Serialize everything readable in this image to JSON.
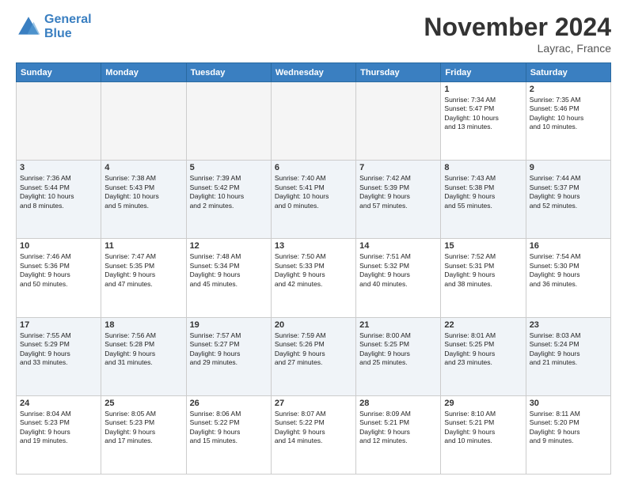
{
  "logo": {
    "line1": "General",
    "line2": "Blue"
  },
  "header": {
    "month": "November 2024",
    "location": "Layrac, France"
  },
  "weekdays": [
    "Sunday",
    "Monday",
    "Tuesday",
    "Wednesday",
    "Thursday",
    "Friday",
    "Saturday"
  ],
  "weeks": [
    [
      {
        "day": "",
        "info": "",
        "empty": true
      },
      {
        "day": "",
        "info": "",
        "empty": true
      },
      {
        "day": "",
        "info": "",
        "empty": true
      },
      {
        "day": "",
        "info": "",
        "empty": true
      },
      {
        "day": "",
        "info": "",
        "empty": true
      },
      {
        "day": "1",
        "info": "Sunrise: 7:34 AM\nSunset: 5:47 PM\nDaylight: 10 hours\nand 13 minutes.",
        "empty": false
      },
      {
        "day": "2",
        "info": "Sunrise: 7:35 AM\nSunset: 5:46 PM\nDaylight: 10 hours\nand 10 minutes.",
        "empty": false
      }
    ],
    [
      {
        "day": "3",
        "info": "Sunrise: 7:36 AM\nSunset: 5:44 PM\nDaylight: 10 hours\nand 8 minutes.",
        "empty": false
      },
      {
        "day": "4",
        "info": "Sunrise: 7:38 AM\nSunset: 5:43 PM\nDaylight: 10 hours\nand 5 minutes.",
        "empty": false
      },
      {
        "day": "5",
        "info": "Sunrise: 7:39 AM\nSunset: 5:42 PM\nDaylight: 10 hours\nand 2 minutes.",
        "empty": false
      },
      {
        "day": "6",
        "info": "Sunrise: 7:40 AM\nSunset: 5:41 PM\nDaylight: 10 hours\nand 0 minutes.",
        "empty": false
      },
      {
        "day": "7",
        "info": "Sunrise: 7:42 AM\nSunset: 5:39 PM\nDaylight: 9 hours\nand 57 minutes.",
        "empty": false
      },
      {
        "day": "8",
        "info": "Sunrise: 7:43 AM\nSunset: 5:38 PM\nDaylight: 9 hours\nand 55 minutes.",
        "empty": false
      },
      {
        "day": "9",
        "info": "Sunrise: 7:44 AM\nSunset: 5:37 PM\nDaylight: 9 hours\nand 52 minutes.",
        "empty": false
      }
    ],
    [
      {
        "day": "10",
        "info": "Sunrise: 7:46 AM\nSunset: 5:36 PM\nDaylight: 9 hours\nand 50 minutes.",
        "empty": false
      },
      {
        "day": "11",
        "info": "Sunrise: 7:47 AM\nSunset: 5:35 PM\nDaylight: 9 hours\nand 47 minutes.",
        "empty": false
      },
      {
        "day": "12",
        "info": "Sunrise: 7:48 AM\nSunset: 5:34 PM\nDaylight: 9 hours\nand 45 minutes.",
        "empty": false
      },
      {
        "day": "13",
        "info": "Sunrise: 7:50 AM\nSunset: 5:33 PM\nDaylight: 9 hours\nand 42 minutes.",
        "empty": false
      },
      {
        "day": "14",
        "info": "Sunrise: 7:51 AM\nSunset: 5:32 PM\nDaylight: 9 hours\nand 40 minutes.",
        "empty": false
      },
      {
        "day": "15",
        "info": "Sunrise: 7:52 AM\nSunset: 5:31 PM\nDaylight: 9 hours\nand 38 minutes.",
        "empty": false
      },
      {
        "day": "16",
        "info": "Sunrise: 7:54 AM\nSunset: 5:30 PM\nDaylight: 9 hours\nand 36 minutes.",
        "empty": false
      }
    ],
    [
      {
        "day": "17",
        "info": "Sunrise: 7:55 AM\nSunset: 5:29 PM\nDaylight: 9 hours\nand 33 minutes.",
        "empty": false
      },
      {
        "day": "18",
        "info": "Sunrise: 7:56 AM\nSunset: 5:28 PM\nDaylight: 9 hours\nand 31 minutes.",
        "empty": false
      },
      {
        "day": "19",
        "info": "Sunrise: 7:57 AM\nSunset: 5:27 PM\nDaylight: 9 hours\nand 29 minutes.",
        "empty": false
      },
      {
        "day": "20",
        "info": "Sunrise: 7:59 AM\nSunset: 5:26 PM\nDaylight: 9 hours\nand 27 minutes.",
        "empty": false
      },
      {
        "day": "21",
        "info": "Sunrise: 8:00 AM\nSunset: 5:25 PM\nDaylight: 9 hours\nand 25 minutes.",
        "empty": false
      },
      {
        "day": "22",
        "info": "Sunrise: 8:01 AM\nSunset: 5:25 PM\nDaylight: 9 hours\nand 23 minutes.",
        "empty": false
      },
      {
        "day": "23",
        "info": "Sunrise: 8:03 AM\nSunset: 5:24 PM\nDaylight: 9 hours\nand 21 minutes.",
        "empty": false
      }
    ],
    [
      {
        "day": "24",
        "info": "Sunrise: 8:04 AM\nSunset: 5:23 PM\nDaylight: 9 hours\nand 19 minutes.",
        "empty": false
      },
      {
        "day": "25",
        "info": "Sunrise: 8:05 AM\nSunset: 5:23 PM\nDaylight: 9 hours\nand 17 minutes.",
        "empty": false
      },
      {
        "day": "26",
        "info": "Sunrise: 8:06 AM\nSunset: 5:22 PM\nDaylight: 9 hours\nand 15 minutes.",
        "empty": false
      },
      {
        "day": "27",
        "info": "Sunrise: 8:07 AM\nSunset: 5:22 PM\nDaylight: 9 hours\nand 14 minutes.",
        "empty": false
      },
      {
        "day": "28",
        "info": "Sunrise: 8:09 AM\nSunset: 5:21 PM\nDaylight: 9 hours\nand 12 minutes.",
        "empty": false
      },
      {
        "day": "29",
        "info": "Sunrise: 8:10 AM\nSunset: 5:21 PM\nDaylight: 9 hours\nand 10 minutes.",
        "empty": false
      },
      {
        "day": "30",
        "info": "Sunrise: 8:11 AM\nSunset: 5:20 PM\nDaylight: 9 hours\nand 9 minutes.",
        "empty": false
      }
    ]
  ]
}
